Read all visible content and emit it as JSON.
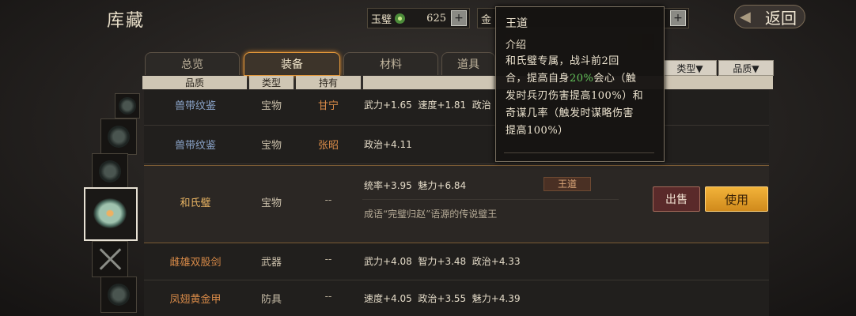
{
  "title": "库藏",
  "resources": {
    "jade": {
      "label": "玉璧",
      "value": "625",
      "icon": "jade-icon"
    },
    "gold": {
      "label": "金",
      "value": ""
    }
  },
  "back_label": "返回",
  "tabs": [
    {
      "label": "总览"
    },
    {
      "label": "装备"
    },
    {
      "label": "材料"
    },
    {
      "label": "道具"
    }
  ],
  "sort_buttons": {
    "type": "类型▼",
    "quality": "品质▼"
  },
  "columns": {
    "quality": "品质",
    "type": "类型",
    "holder": "持有"
  },
  "items": [
    {
      "name": "兽带纹鉴",
      "type": "宝物",
      "holder": "甘宁",
      "stats": "武力+1.65  速度+1.81  政治"
    },
    {
      "name": "兽带纹鉴",
      "type": "宝物",
      "holder": "张昭",
      "stats": "政治+4.11"
    },
    {
      "name": "和氏璧",
      "type": "宝物",
      "holder": "--",
      "stats": "统率+3.95  魅力+6.84",
      "tag": "王道",
      "desc": "成语“完璧归赵”语源的传说璧王"
    },
    {
      "name": "雌雄双股剑",
      "type": "武器",
      "holder": "--",
      "stats": "武力+4.08  智力+3.48  政治+4.33"
    },
    {
      "name": "凤翅黄金甲",
      "type": "防具",
      "holder": "--",
      "stats": "速度+4.05  政治+3.55  魅力+4.39"
    }
  ],
  "actions": {
    "sell": "出售",
    "use": "使用"
  },
  "tooltip": {
    "title": "王道",
    "section": "介绍",
    "line1": "和氏璧专属，战斗前2回",
    "line2a": "合，提高自身",
    "line2b": "20%",
    "line2c": "会心（触",
    "line3": "发时兵刃伤害提高100%）和",
    "line4": "奇谋几率（触发时谋略伤害",
    "line5": "提高100%）"
  },
  "colors": {
    "accent": "#e2973a",
    "use_button": "#e8a030",
    "sell_button": "#5a2a2a",
    "highlight_green": "#63c35a"
  }
}
